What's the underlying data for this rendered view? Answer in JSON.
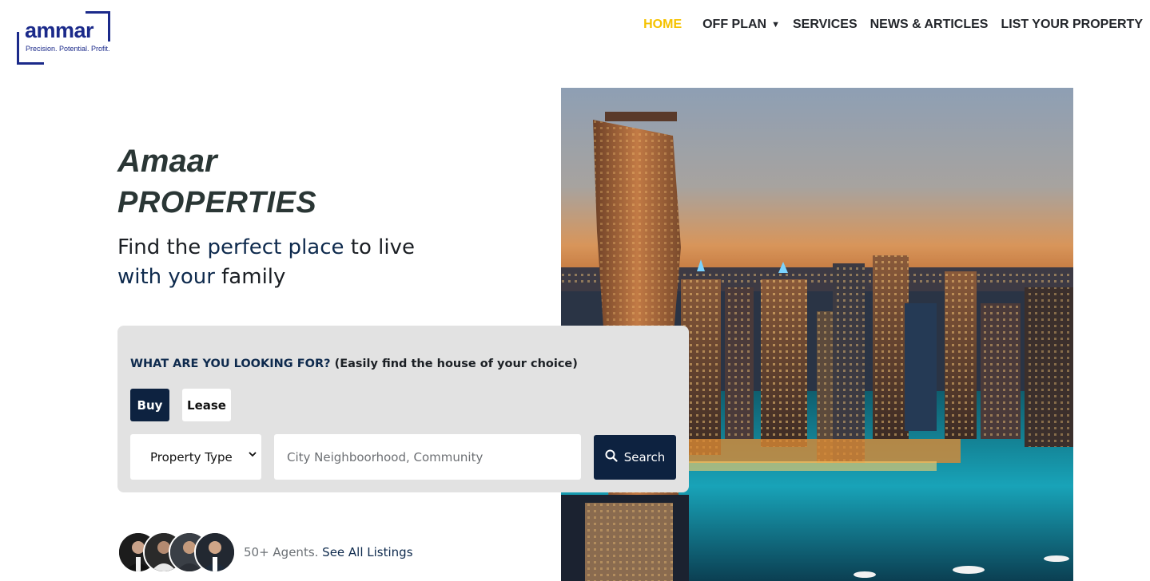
{
  "logo": {
    "wordmark": "ammar",
    "tagline": "Precision. Potential. Profit."
  },
  "nav": {
    "home": "HOME",
    "off_plan": "OFF PLAN",
    "services": "SERVICES",
    "news": "NEWS & ARTICLES",
    "list_property": "LIST YOUR PROPERTY"
  },
  "hero": {
    "brand_line1": "Amaar",
    "brand_line2": "PROPERTIES",
    "tagline": {
      "p1": "Find the ",
      "h1": "perfect place",
      "p2": " to live ",
      "h2": "with your",
      "p3": " family"
    }
  },
  "search": {
    "heading_highlight": "WHAT ARE YOU LOOKING FOR?",
    "heading_rest": " (Easily find the house of your choice)",
    "tab_buy": "Buy",
    "tab_lease": "Lease",
    "property_type": "Property Type",
    "location_placeholder": "City Neighboorhood, Community",
    "search_label": "Search"
  },
  "agents": {
    "count_text": "50+ Agents.",
    "link_text": " See All Listings"
  },
  "colors": {
    "accent_active": "#f5c200",
    "primary_navy": "#0d2240",
    "logo_blue": "#1b2a8a"
  }
}
